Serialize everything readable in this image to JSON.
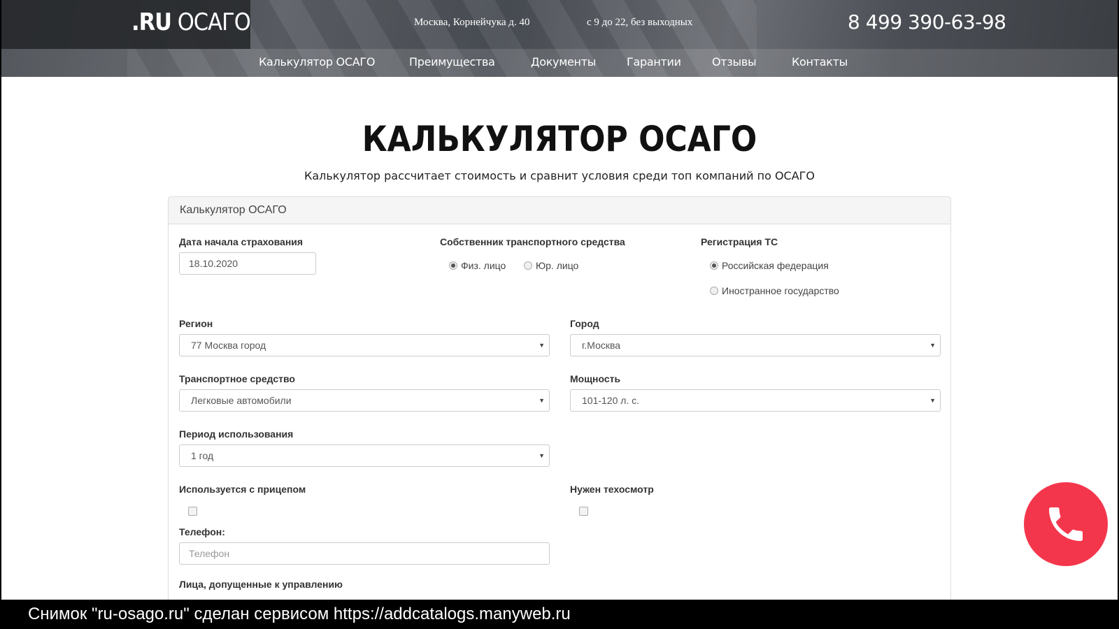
{
  "header": {
    "logo_prefix": ".RU",
    "logo_suffix": "ОСАГО",
    "address": "Москва, Корнейчука д. 40",
    "hours": "с 9 до 22, без выходных",
    "phone": "8 499 390-63-98"
  },
  "nav": {
    "items": [
      {
        "label": "Калькулятор ОСАГО"
      },
      {
        "label": "Преимущества"
      },
      {
        "label": "Документы"
      },
      {
        "label": "Гарантии"
      },
      {
        "label": "Отзывы"
      },
      {
        "label": "Контакты"
      }
    ]
  },
  "main": {
    "title": "КАЛЬКУЛЯТОР ОСАГО",
    "subtitle": "Калькулятор рассчитает стоимость и сравнит условия среди топ компаний по ОСАГО"
  },
  "form": {
    "heading": "Калькулятор ОСАГО",
    "start_date": {
      "label": "Дата начала страхования",
      "value": "18.10.2020"
    },
    "owner": {
      "label": "Собственник транспортного средства",
      "options": [
        {
          "label": "Физ. лицо",
          "selected": true
        },
        {
          "label": "Юр. лицо",
          "selected": false
        }
      ]
    },
    "registration": {
      "label": "Регистрация ТС",
      "options": [
        {
          "label": "Российская федерация",
          "selected": true
        },
        {
          "label": "Иностранное государство",
          "selected": false
        }
      ]
    },
    "region": {
      "label": "Регион",
      "value": "77 Москва город"
    },
    "city": {
      "label": "Город",
      "value": "г.Москва"
    },
    "vehicle": {
      "label": "Транспортное средство",
      "value": "Легковые автомобили"
    },
    "power": {
      "label": "Мощность",
      "value": "101-120 л. с."
    },
    "period": {
      "label": "Период использования",
      "value": "1 год"
    },
    "trailer": {
      "label": "Используется с прицепом",
      "checked": false
    },
    "inspection": {
      "label": "Нужен техосмотр",
      "checked": false
    },
    "phone": {
      "label": "Телефон:",
      "placeholder": "Телефон"
    },
    "drivers": {
      "label": "Лица, допущенные к управлению"
    }
  },
  "call_button": {
    "icon": "phone-icon",
    "color": "#f4364c"
  },
  "footer": {
    "text": "Снимок \"ru-osago.ru\" сделан сервисом https://addcatalogs.manyweb.ru"
  }
}
